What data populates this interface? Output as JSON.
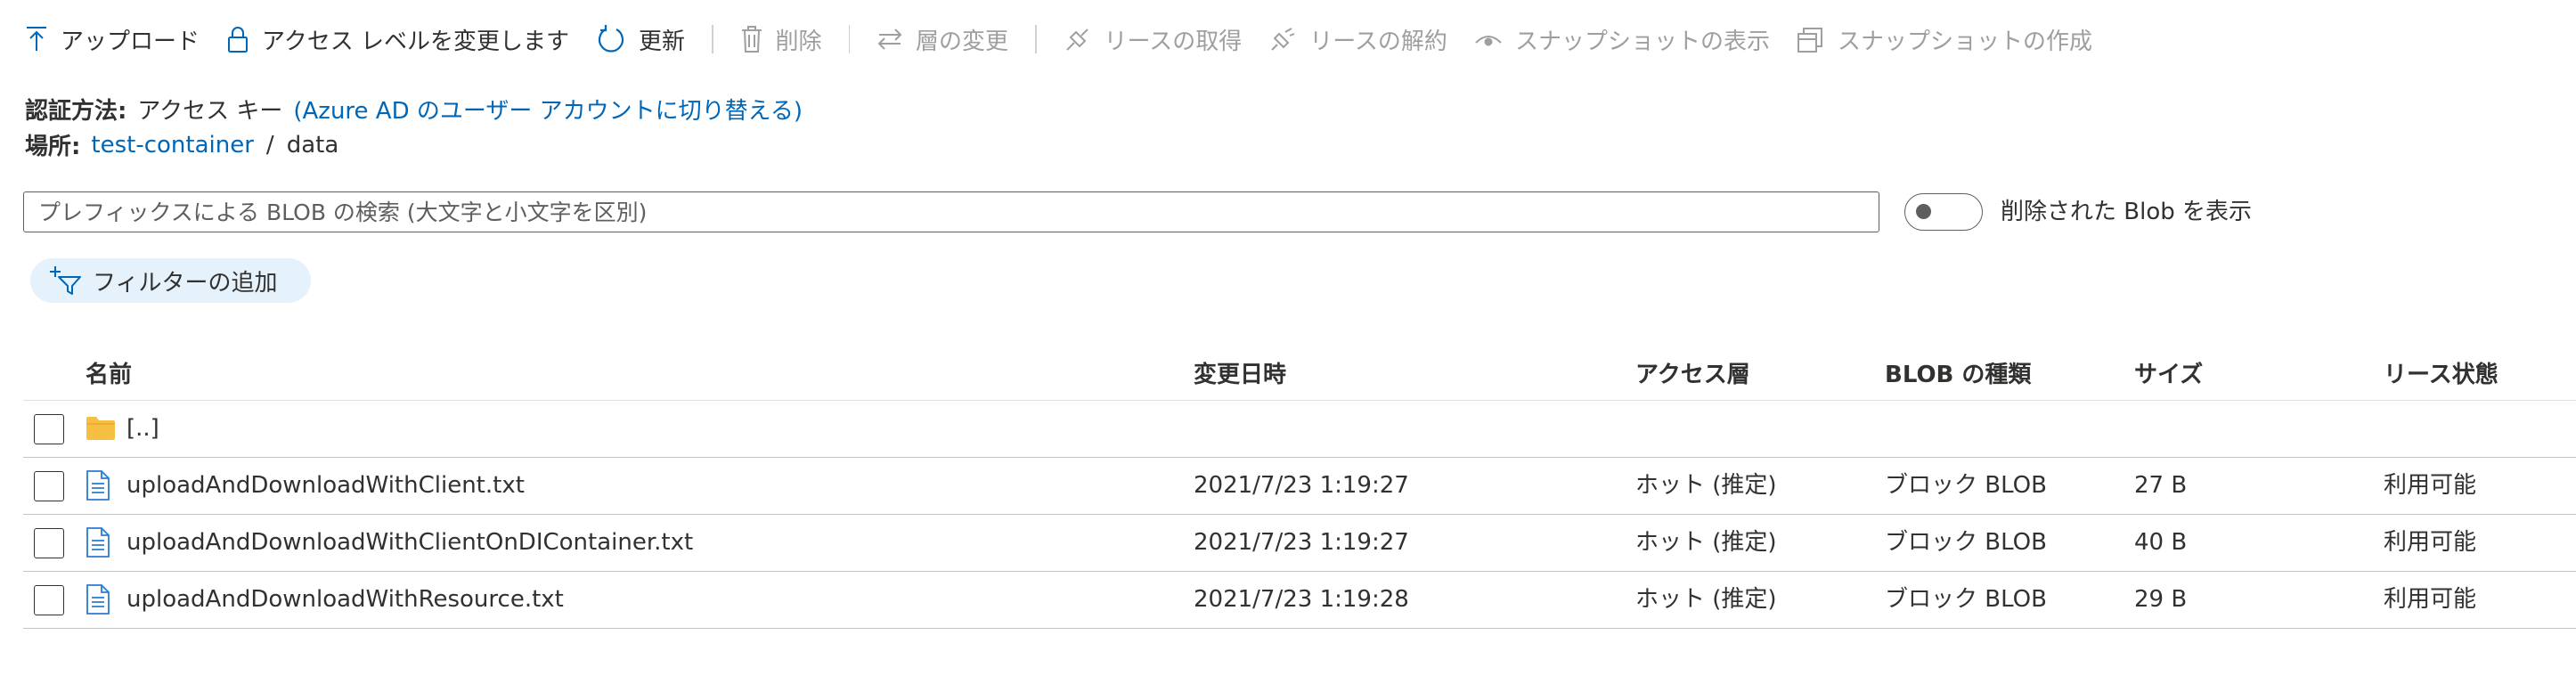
{
  "toolbar": {
    "upload": "アップロード",
    "change_access": "アクセス レベルを変更します",
    "refresh": "更新",
    "delete": "削除",
    "change_tier": "層の変更",
    "acquire_lease": "リースの取得",
    "break_lease": "リースの解約",
    "view_snapshots": "スナップショットの表示",
    "create_snapshot": "スナップショットの作成"
  },
  "auth": {
    "label": "認証方法:",
    "value": "アクセス キー",
    "switch_link": "(Azure AD のユーザー アカウントに切り替える)"
  },
  "location": {
    "label": "場所:",
    "container": "test-container",
    "separator": "/",
    "folder": "data"
  },
  "search": {
    "placeholder": "プレフィックスによる BLOB の検索 (大文字と小文字を区別)"
  },
  "show_deleted": {
    "label": "削除された Blob を表示",
    "enabled": false
  },
  "filter": {
    "label": "フィルターの追加"
  },
  "table": {
    "headers": {
      "name": "名前",
      "modified": "変更日時",
      "tier": "アクセス層",
      "blob_type": "BLOB の種類",
      "size": "サイズ",
      "lease": "リース状態"
    },
    "parent": "[..]",
    "rows": [
      {
        "name": "uploadAndDownloadWithClient.txt",
        "modified": "2021/7/23 1:19:27",
        "tier": "ホット (推定)",
        "blob_type": "ブロック BLOB",
        "size": "27 B",
        "lease": "利用可能"
      },
      {
        "name": "uploadAndDownloadWithClientOnDIContainer.txt",
        "modified": "2021/7/23 1:19:27",
        "tier": "ホット (推定)",
        "blob_type": "ブロック BLOB",
        "size": "40 B",
        "lease": "利用可能"
      },
      {
        "name": "uploadAndDownloadWithResource.txt",
        "modified": "2021/7/23 1:19:28",
        "tier": "ホット (推定)",
        "blob_type": "ブロック BLOB",
        "size": "29 B",
        "lease": "利用可能"
      }
    ]
  },
  "colors": {
    "accent": "#0067b8",
    "folder": "#f4bf42",
    "disabled_text": "#a19f9d",
    "pill_bg": "#e5f1fb"
  }
}
